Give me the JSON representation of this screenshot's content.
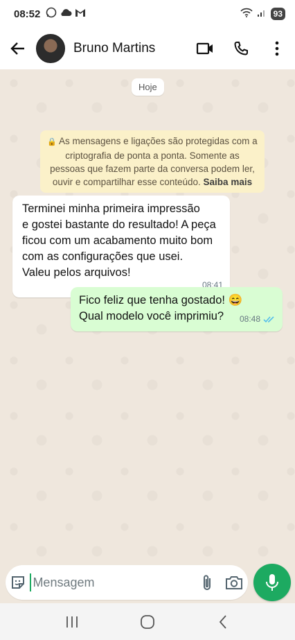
{
  "status_bar": {
    "time": "08:52",
    "battery": "93",
    "icons_left": [
      "whatsapp-icon",
      "cloud-icon",
      "gmail-icon"
    ],
    "icons_right": [
      "wifi-icon",
      "signal-icon",
      "battery-icon"
    ]
  },
  "header": {
    "contact_name": "Bruno Martins",
    "actions": [
      "video-call-icon",
      "voice-call-icon",
      "more-options-icon"
    ]
  },
  "chat": {
    "date_chip": "Hoje",
    "encryption_notice": {
      "text": "As mensagens e ligações são protegidas com a criptografia de ponta a ponta. Somente as pessoas que fazem parte da conversa podem ler, ouvir e compartilhar esse conteúdo.",
      "link": "Saiba mais"
    },
    "messages": [
      {
        "direction": "incoming",
        "lines": [
          "Terminei minha primeira impressão",
          "e gostei bastante do resultado! A peça",
          "ficou com um acabamento muito bom",
          "com as configurações que usei.",
          "Valeu pelos arquivos!"
        ],
        "time": "08:41"
      },
      {
        "direction": "outgoing",
        "lines": [
          "Fico feliz que tenha gostado! 😄",
          "Qual modelo você imprimiu?"
        ],
        "time": "08:48",
        "status": "read"
      }
    ]
  },
  "composer": {
    "placeholder": "Mensagem",
    "value": ""
  },
  "colors": {
    "accent": "#1daa61",
    "outgoing_bubble": "#d9fdd3",
    "notice_bg": "#fbf1c9",
    "chat_bg": "#efe7dd",
    "read_ticks": "#53bdeb"
  }
}
